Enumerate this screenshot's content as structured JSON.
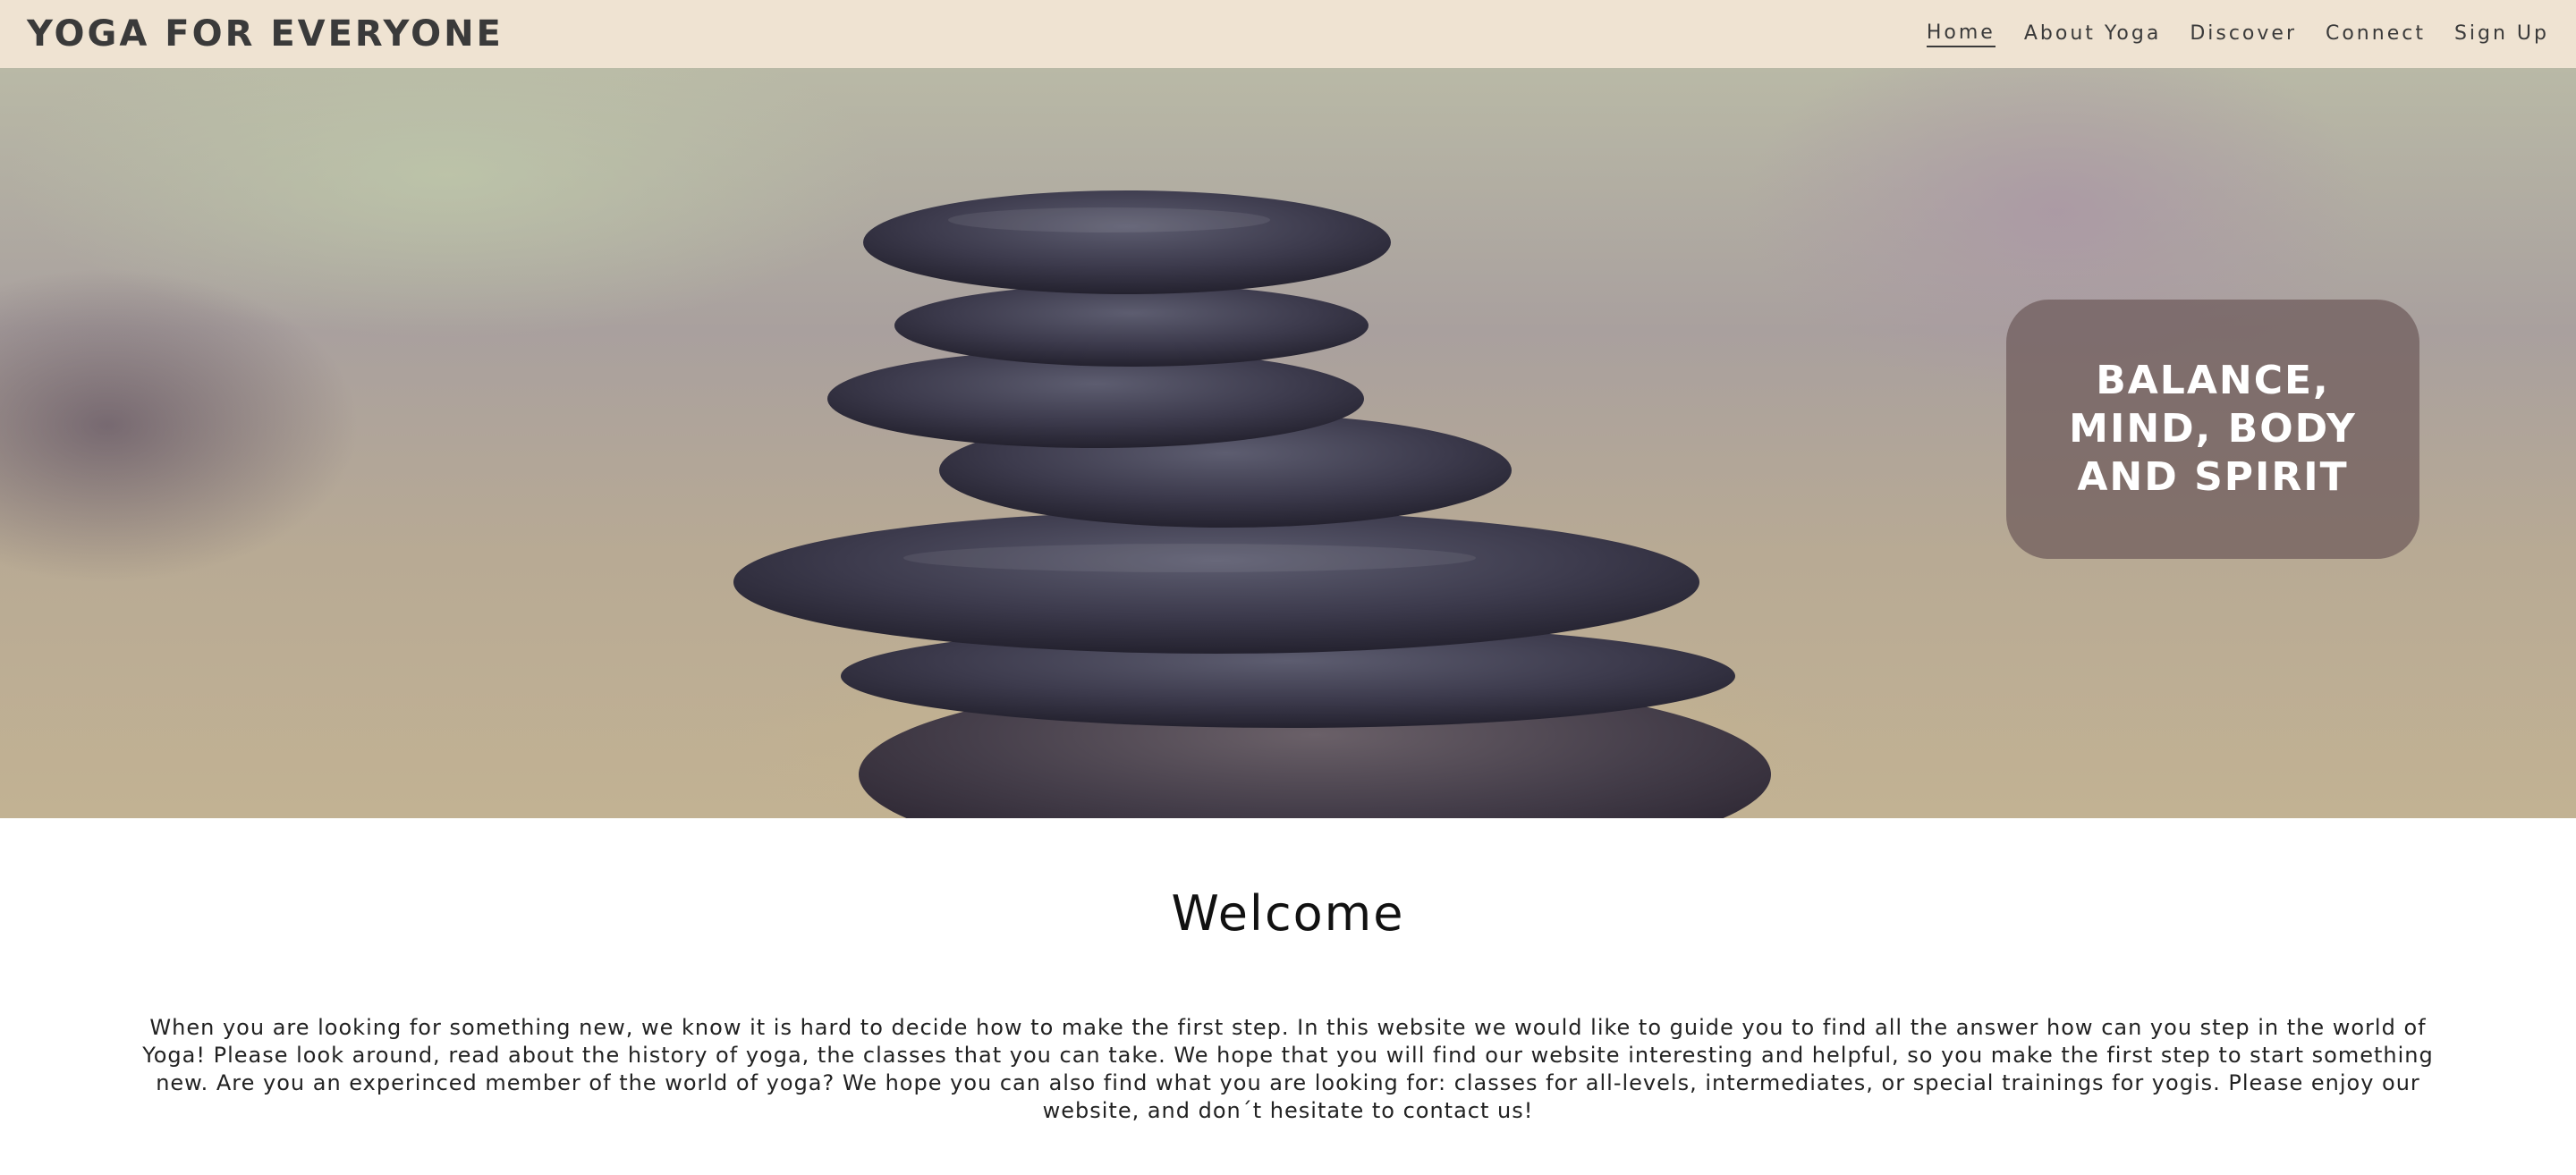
{
  "header": {
    "brand": "YOGA FOR EVERYONE",
    "nav": [
      {
        "label": "Home",
        "active": true
      },
      {
        "label": "About Yoga",
        "active": false
      },
      {
        "label": "Discover",
        "active": false
      },
      {
        "label": "Connect",
        "active": false
      },
      {
        "label": "Sign Up",
        "active": false
      }
    ]
  },
  "hero": {
    "tagline": "BALANCE, MIND, BODY AND SPIRIT"
  },
  "main": {
    "title": "Welcome",
    "intro": "When you are looking for something new, we know it is hard to decide how to make the first step. In this website we would like to guide you to find all the answer how can you step in the world of Yoga! Please look around, read about the history of yoga, the classes that you can take. We hope that you will find our website interesting and helpful, so you make the first step to start something new. Are you an experinced member of the world of yoga? We hope you can also find what you are looking for: classes for all-levels, intermediates, or special trainings for yogis. Please enjoy our website, and don´t hesitate to contact us!"
  },
  "colors": {
    "navbar_bg": "#efe3d2",
    "tagline_box_bg": "#6e5a5a"
  }
}
